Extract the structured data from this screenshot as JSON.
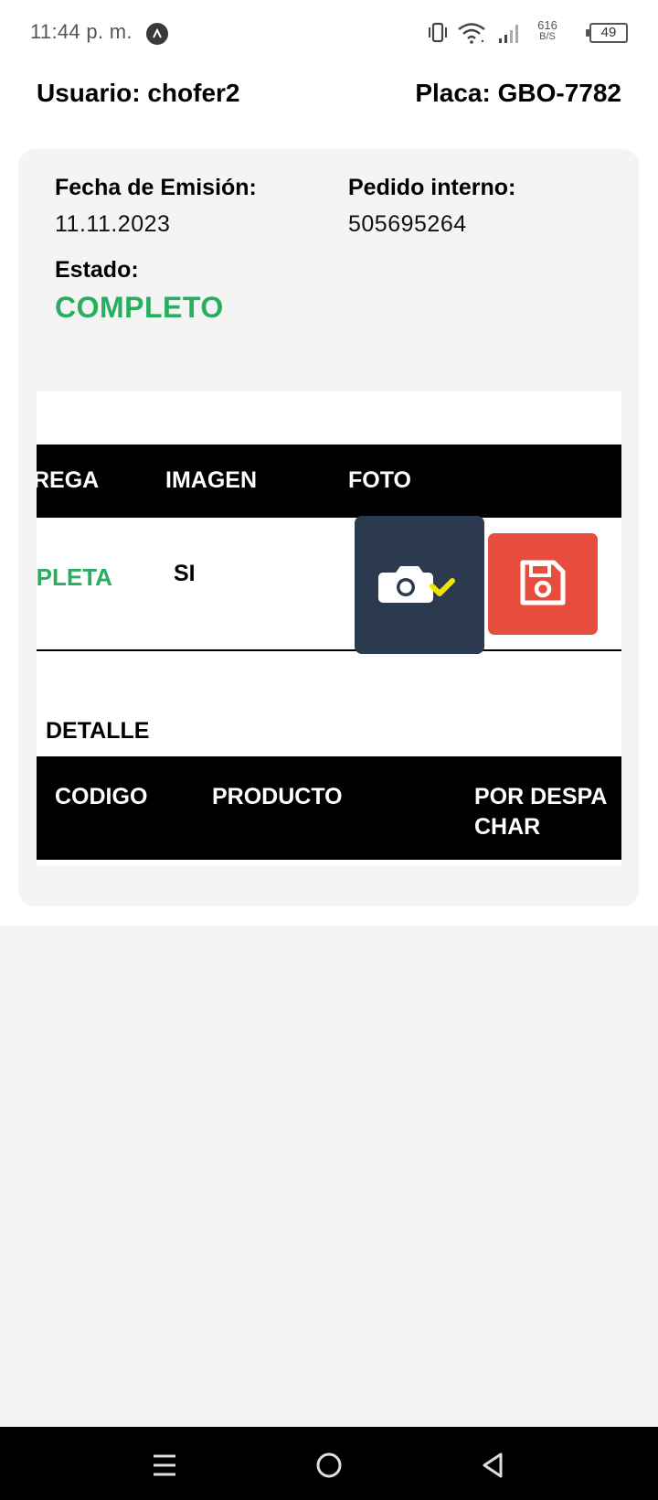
{
  "status_bar": {
    "time": "11:44 p. m.",
    "network_speed_value": "616",
    "network_speed_unit": "B/S",
    "battery_level": "49"
  },
  "header": {
    "user_label": "Usuario: chofer2",
    "plate_label": "Placa: GBO-7782"
  },
  "order": {
    "emission_date_label": "Fecha de Emisión:",
    "emission_date": "11.11.2023",
    "internal_order_label": "Pedido interno:",
    "internal_order": "505695264",
    "status_label": "Estado:",
    "status": "COMPLETO",
    "status_color": "#27ae60"
  },
  "delivery_table": {
    "columns": [
      "REGA",
      "IMAGEN",
      "FOTO"
    ],
    "row": {
      "entrega": "MPLETA",
      "imagen": "SI"
    }
  },
  "detail": {
    "title": "DETALLE",
    "columns": [
      "CODIGO",
      "PRODUCTO",
      "POR DESPA",
      "CHAR"
    ]
  },
  "colors": {
    "photo_button": "#2c3a4f",
    "save_button": "#e74c3c",
    "check_mark": "#f1e400"
  },
  "icons": {
    "photo_button_icon": "camera-check-icon",
    "save_button_icon": "floppy-disk-icon",
    "nav_menu": "menu-icon",
    "nav_home": "home-icon",
    "nav_back": "back-icon"
  }
}
